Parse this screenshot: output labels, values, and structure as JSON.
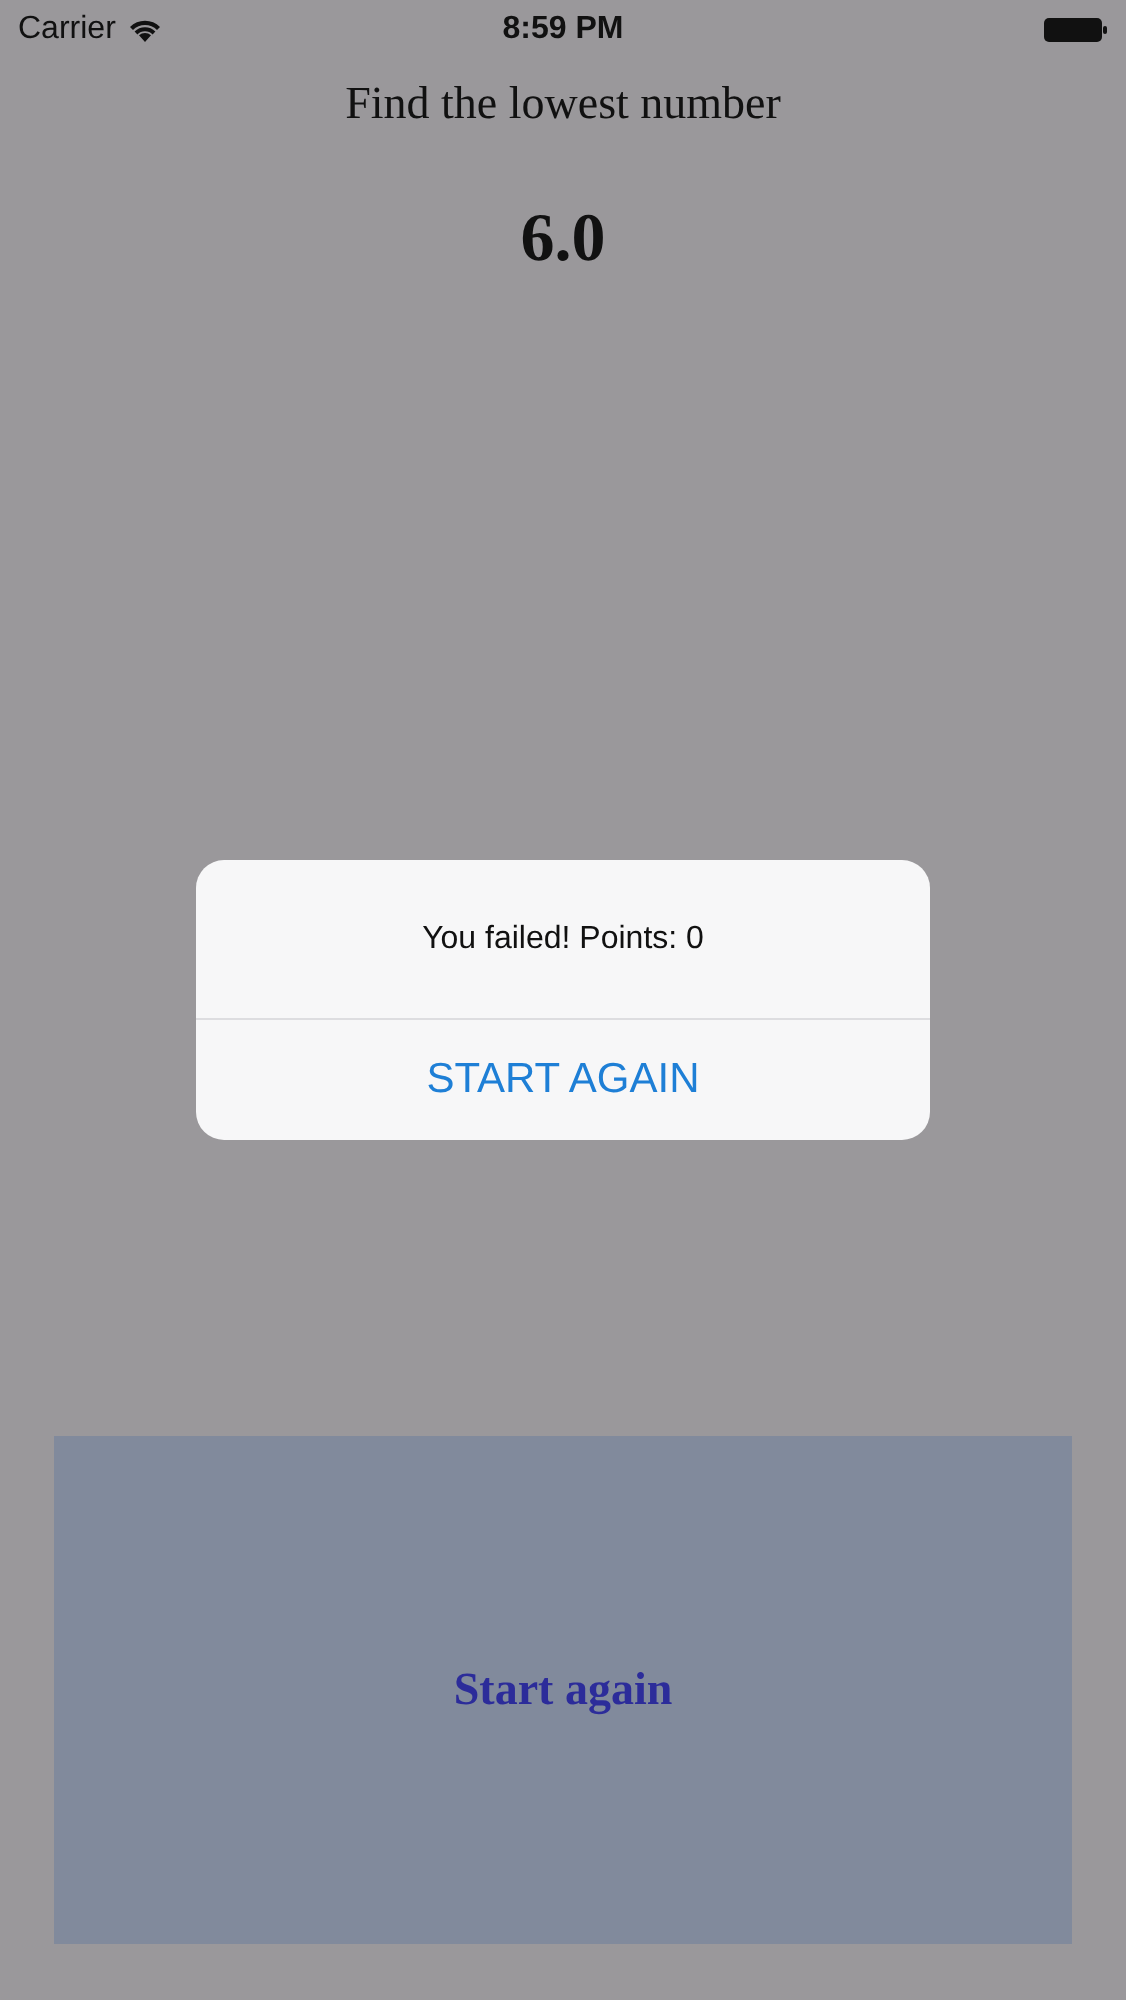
{
  "status_bar": {
    "carrier": "Carrier",
    "time": "8:59 PM"
  },
  "prompt": "Find the lowest number",
  "number": "6.0",
  "bottom_button": {
    "label": "Start again"
  },
  "alert": {
    "message": "You failed! Points: 0",
    "button": "START AGAIN"
  }
}
